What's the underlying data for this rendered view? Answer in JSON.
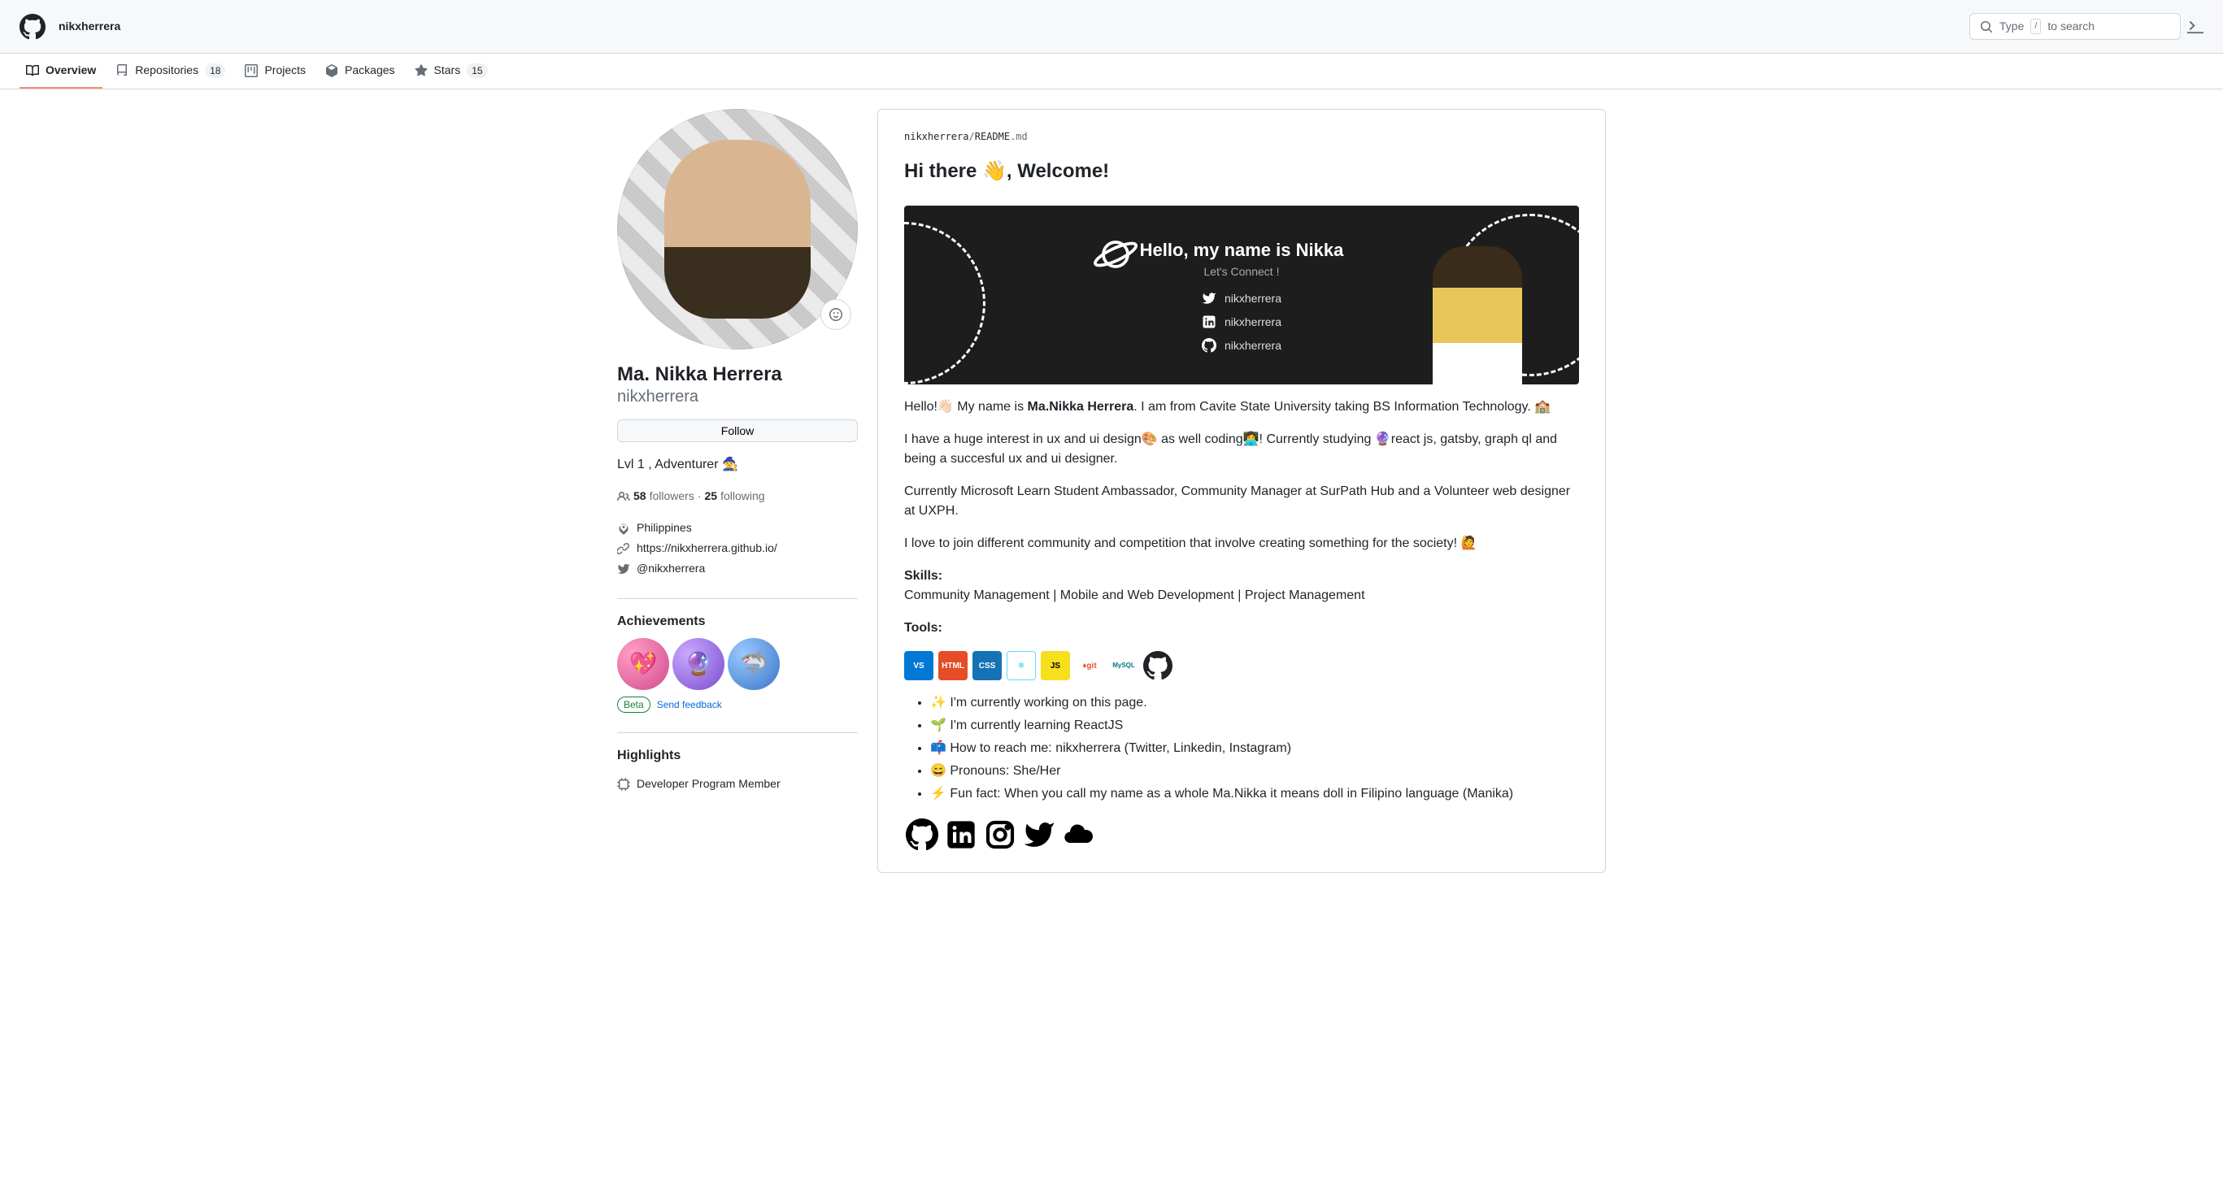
{
  "header": {
    "username": "nikxherrera",
    "search_placeholder": "Type",
    "search_hint": "to search"
  },
  "tabs": [
    {
      "icon": "book-icon",
      "label": "Overview",
      "count": null,
      "active": true
    },
    {
      "icon": "repo-icon",
      "label": "Repositories",
      "count": "18",
      "active": false
    },
    {
      "icon": "project-icon",
      "label": "Projects",
      "count": null,
      "active": false
    },
    {
      "icon": "package-icon",
      "label": "Packages",
      "count": null,
      "active": false
    },
    {
      "icon": "star-icon",
      "label": "Stars",
      "count": "15",
      "active": false
    }
  ],
  "profile": {
    "name": "Ma. Nikka Herrera",
    "login": "nikxherrera",
    "follow_label": "Follow",
    "bio": "Lvl 1 , Adventurer 🧙",
    "followers_count": "58",
    "followers_label": "followers",
    "following_count": "25",
    "following_label": "following",
    "location": "Philippines",
    "website": "https://nikxherrera.github.io/",
    "twitter": "@nikxherrera"
  },
  "achievements": {
    "title": "Achievements",
    "beta_label": "Beta",
    "feedback_label": "Send feedback"
  },
  "highlights": {
    "title": "Highlights",
    "items": [
      "Developer Program Member"
    ]
  },
  "readme": {
    "file_user": "nikxherrera",
    "file_sep": "/",
    "file_name": "README",
    "file_ext": ".md",
    "greeting": "Hi there 👋, Welcome!",
    "banner_title": "Hello, my name is Nikka",
    "banner_sub": "Let's Connect !",
    "banner_handle": "nikxherrera",
    "p1_pre": "Hello!👋🏻 My name is ",
    "p1_bold": "Ma.Nikka Herrera",
    "p1_post": ". I am from Cavite State University taking BS Information Technology. 🏫",
    "p2": "I have a huge interest in ux and ui design🎨 as well coding👩‍💻! Currently studying 🔮react js, gatsby, graph ql and being a succesful ux and ui designer.",
    "p3": "Currently Microsoft Learn Student Ambassador, Community Manager at SurPath Hub and a Volunteer web designer at UXPH.",
    "p4": "I love to join different community and competition that involve creating something for the society! 🙋",
    "skills_label": "Skills:",
    "skills_text": "Community Management | Mobile and Web Development | Project Management",
    "tools_label": "Tools:",
    "tools": [
      "VSCode",
      "HTML",
      "CSS",
      "React",
      "JS",
      "Git",
      "MySQL",
      "GitHub"
    ],
    "bullets": [
      "✨ I'm currently working on this page.",
      "🌱 I'm currently learning ReactJS",
      "📫 How to reach me: nikxherrera (Twitter, Linkedin, Instagram)",
      "😄 Pronouns: She/Her",
      "⚡ Fun fact: When you call my name as a whole Ma.Nikka it means doll in Filipino language (Manika)"
    ]
  }
}
